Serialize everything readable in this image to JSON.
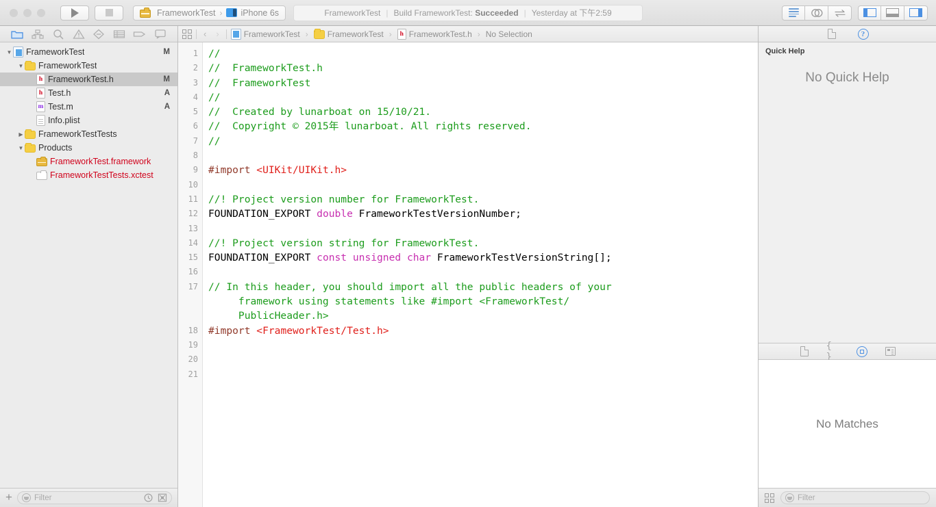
{
  "toolbar": {
    "run_icon": "play-icon",
    "stop_icon": "stop-icon",
    "scheme": {
      "project": "FrameworkTest",
      "separator": "›",
      "destination": "iPhone 6s"
    },
    "status": {
      "target": "FrameworkTest",
      "divider": "|",
      "action_prefix": "Build FrameworkTest:",
      "action_result": "Succeeded",
      "timestamp": "Yesterday at 下午2:59"
    },
    "right_buttons": [
      {
        "name": "standard-editor-button",
        "icon": "lines-icon",
        "active": true
      },
      {
        "name": "assistant-editor-button",
        "icon": "venn-icon",
        "active": false
      },
      {
        "name": "version-editor-button",
        "icon": "arrows-swap-icon",
        "active": false
      },
      {
        "name": "toggle-navigator-button",
        "icon": "left-pane-icon",
        "active": true
      },
      {
        "name": "toggle-debug-area-button",
        "icon": "bottom-pane-icon",
        "active": false
      },
      {
        "name": "toggle-utilities-button",
        "icon": "right-pane-icon",
        "active": true
      }
    ]
  },
  "navigator": {
    "tabs": [
      {
        "name": "project-navigator-tab",
        "icon": "folder-icon",
        "active": true
      },
      {
        "name": "symbol-navigator-tab",
        "icon": "hierarchy-icon",
        "active": false
      },
      {
        "name": "find-navigator-tab",
        "icon": "search-icon",
        "active": false
      },
      {
        "name": "issue-navigator-tab",
        "icon": "warning-triangle-icon",
        "active": false
      },
      {
        "name": "test-navigator-tab",
        "icon": "diamond-icon",
        "active": false
      },
      {
        "name": "debug-navigator-tab",
        "icon": "list-icon",
        "active": false
      },
      {
        "name": "breakpoint-navigator-tab",
        "icon": "tag-icon",
        "active": false
      },
      {
        "name": "report-navigator-tab",
        "icon": "speech-bubble-icon",
        "active": false
      }
    ],
    "tree": [
      {
        "label": "FrameworkTest",
        "icon": "project-icon",
        "indent": 0,
        "twist": "open",
        "badge": "M",
        "selected": false
      },
      {
        "label": "FrameworkTest",
        "icon": "folder-icon",
        "indent": 1,
        "twist": "open",
        "badge": "",
        "selected": false
      },
      {
        "label": "FrameworkTest.h",
        "icon": "header-file-icon",
        "indent": 2,
        "twist": "",
        "badge": "M",
        "selected": true
      },
      {
        "label": "Test.h",
        "icon": "header-file-icon",
        "indent": 2,
        "twist": "",
        "badge": "A",
        "selected": false
      },
      {
        "label": "Test.m",
        "icon": "source-file-icon",
        "indent": 2,
        "twist": "",
        "badge": "A",
        "selected": false
      },
      {
        "label": "Info.plist",
        "icon": "plist-file-icon",
        "indent": 2,
        "twist": "",
        "badge": "",
        "selected": false
      },
      {
        "label": "FrameworkTestTests",
        "icon": "folder-icon",
        "indent": 1,
        "twist": "closed",
        "badge": "",
        "selected": false
      },
      {
        "label": "Products",
        "icon": "folder-icon",
        "indent": 1,
        "twist": "open",
        "badge": "",
        "selected": false
      },
      {
        "label": "FrameworkTest.framework",
        "icon": "framework-icon",
        "indent": 2,
        "twist": "",
        "badge": "",
        "selected": false,
        "red": true
      },
      {
        "label": "FrameworkTestTests.xctest",
        "icon": "xctest-icon",
        "indent": 2,
        "twist": "",
        "badge": "",
        "selected": false,
        "red": true
      }
    ],
    "footer": {
      "add_label": "+",
      "filter_placeholder": "Filter",
      "recent_icon": "clock-icon",
      "source_control_icon": "target-box-icon"
    }
  },
  "editor": {
    "jumpbar": {
      "related_items_icon": "grid-icon",
      "back_icon": "‹",
      "forward_icon": "›",
      "crumbs": [
        {
          "label": "FrameworkTest",
          "icon": "project-icon"
        },
        {
          "label": "FrameworkTest",
          "icon": "folder-icon"
        },
        {
          "label": "FrameworkTest.h",
          "icon": "header-file-icon"
        },
        {
          "label": "No Selection",
          "icon": ""
        }
      ],
      "crumb_separator": "›"
    },
    "line_numbers": [
      "1",
      "2",
      "3",
      "4",
      "5",
      "6",
      "7",
      "8",
      "9",
      "10",
      "11",
      "12",
      "13",
      "14",
      "15",
      "16",
      "17",
      "",
      "",
      "18",
      "19",
      "20",
      "21"
    ],
    "lines": [
      {
        "n": "1",
        "tokens": [
          {
            "t": "//",
            "c": "comment"
          }
        ]
      },
      {
        "n": "2",
        "tokens": [
          {
            "t": "//  FrameworkTest.h",
            "c": "comment"
          }
        ]
      },
      {
        "n": "3",
        "tokens": [
          {
            "t": "//  FrameworkTest",
            "c": "comment"
          }
        ]
      },
      {
        "n": "4",
        "tokens": [
          {
            "t": "//",
            "c": "comment"
          }
        ]
      },
      {
        "n": "5",
        "tokens": [
          {
            "t": "//  Created by lunarboat on 15/10/21.",
            "c": "comment"
          }
        ]
      },
      {
        "n": "6",
        "tokens": [
          {
            "t": "//  Copyright © 2015年 lunarboat. All rights reserved.",
            "c": "comment"
          }
        ]
      },
      {
        "n": "7",
        "tokens": [
          {
            "t": "//",
            "c": "comment"
          }
        ]
      },
      {
        "n": "8",
        "tokens": [
          {
            "t": "",
            "c": "plain"
          }
        ]
      },
      {
        "n": "9",
        "tokens": [
          {
            "t": "#import ",
            "c": "preproc"
          },
          {
            "t": "<UIKit/UIKit.h>",
            "c": "string"
          }
        ]
      },
      {
        "n": "10",
        "tokens": [
          {
            "t": "",
            "c": "plain"
          }
        ]
      },
      {
        "n": "11",
        "tokens": [
          {
            "t": "//! Project version number for FrameworkTest.",
            "c": "comment"
          }
        ]
      },
      {
        "n": "12",
        "tokens": [
          {
            "t": "FOUNDATION_EXPORT ",
            "c": "plain"
          },
          {
            "t": "double",
            "c": "keyword"
          },
          {
            "t": " FrameworkTestVersionNumber;",
            "c": "plain"
          }
        ]
      },
      {
        "n": "13",
        "tokens": [
          {
            "t": "",
            "c": "plain"
          }
        ]
      },
      {
        "n": "14",
        "tokens": [
          {
            "t": "//! Project version string for FrameworkTest.",
            "c": "comment"
          }
        ]
      },
      {
        "n": "15",
        "tokens": [
          {
            "t": "FOUNDATION_EXPORT ",
            "c": "plain"
          },
          {
            "t": "const unsigned char",
            "c": "keyword"
          },
          {
            "t": " FrameworkTestVersionString[];",
            "c": "plain"
          }
        ]
      },
      {
        "n": "16",
        "tokens": [
          {
            "t": "",
            "c": "plain"
          }
        ]
      },
      {
        "n": "17",
        "tokens": [
          {
            "t": "// In this header, you should import all the public headers of your",
            "c": "comment"
          }
        ]
      },
      {
        "n": "",
        "tokens": [
          {
            "t": "     framework using statements like #import <FrameworkTest/",
            "c": "comment"
          }
        ]
      },
      {
        "n": "",
        "tokens": [
          {
            "t": "     PublicHeader.h>",
            "c": "comment"
          }
        ]
      },
      {
        "n": "18",
        "tokens": [
          {
            "t": "#import ",
            "c": "preproc"
          },
          {
            "t": "<FrameworkTest/Test.h>",
            "c": "string"
          }
        ]
      },
      {
        "n": "19",
        "tokens": [
          {
            "t": "",
            "c": "plain"
          }
        ]
      },
      {
        "n": "20",
        "tokens": [
          {
            "t": "",
            "c": "plain"
          }
        ]
      },
      {
        "n": "21",
        "tokens": [
          {
            "t": "",
            "c": "plain"
          }
        ]
      }
    ]
  },
  "inspector": {
    "tabs": [
      {
        "name": "file-inspector-tab",
        "icon": "document-icon",
        "active": false
      },
      {
        "name": "quick-help-inspector-tab",
        "icon": "help-circle-icon",
        "active": true
      }
    ],
    "quick_help": {
      "title": "Quick Help",
      "empty_message": "No Quick Help"
    },
    "library_tabs": [
      {
        "name": "file-template-library-tab",
        "icon": "document-icon",
        "active": false
      },
      {
        "name": "code-snippet-library-tab",
        "icon": "braces-icon",
        "active": false
      },
      {
        "name": "object-library-tab",
        "icon": "circle-square-icon",
        "active": true
      },
      {
        "name": "media-library-tab",
        "icon": "media-icon",
        "active": false
      }
    ],
    "library": {
      "empty_message": "No Matches"
    },
    "footer": {
      "grid_icon": "grid-icon",
      "filter_placeholder": "Filter"
    }
  },
  "colors": {
    "accent": "#4c90e2",
    "comment": "#1c9c1c",
    "keyword": "#c72fb0",
    "string": "#e0201b",
    "preproc": "#913a2b",
    "product_red": "#d0021b",
    "folder_yellow": "#f5cf44"
  }
}
